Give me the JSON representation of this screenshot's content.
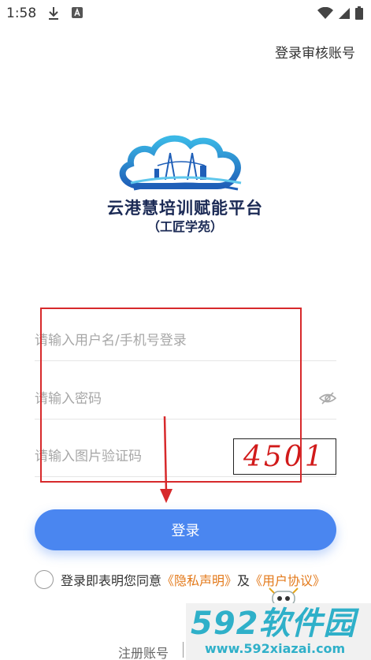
{
  "status_bar": {
    "time": "1:58"
  },
  "header": {
    "review_account_link": "登录审核账号"
  },
  "logo": {
    "title": "云港慧培训赋能平台",
    "subtitle": "（工匠学苑）"
  },
  "form": {
    "username_placeholder": "请输入用户名/手机号登录",
    "password_placeholder": "请输入密码",
    "captcha_placeholder": "请输入图片验证码",
    "captcha_code": "4501"
  },
  "login_button": "登录",
  "agreement": {
    "prefix": "登录即表明您同意",
    "privacy": "《隐私声明》",
    "and": "及",
    "terms": "《用户协议》"
  },
  "footer": {
    "register_link": "注册账号"
  },
  "watermark": {
    "main": "592软件园",
    "url": "www.592xiazai.com"
  },
  "colors": {
    "primary": "#4a86f0",
    "link": "#e3791a",
    "annotation": "#d7292b",
    "brand_navy": "#1b2a55"
  }
}
